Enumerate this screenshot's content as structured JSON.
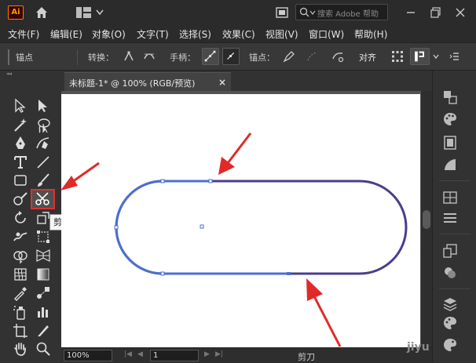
{
  "app": {
    "logo_text": "Ai"
  },
  "search": {
    "placeholder": "搜索 Adobe 帮助"
  },
  "menu": {
    "items": [
      "文件(F)",
      "编辑(E)",
      "对象(O)",
      "文字(T)",
      "选择(S)",
      "效果(C)",
      "视图(V)",
      "窗口(W)",
      "帮助(H)"
    ]
  },
  "control": {
    "anchor_label": "锚点",
    "convert_label": "转换：",
    "handle_label": "手柄：",
    "anchor_point_label": "锚点：",
    "align_label": "对齐"
  },
  "document": {
    "tab_title": "未标题-1* @ 100% (RGB/预览)",
    "close_glyph": "×"
  },
  "tooltip": {
    "text": "剪刀工具 (C)"
  },
  "status": {
    "zoom": "100%",
    "page": "1",
    "current_tool": "剪刀"
  },
  "watermark": {
    "text": "jiyu"
  },
  "colors": {
    "path_stroke": "#4b3c8c",
    "selection_blue": "#4a6fd0",
    "arrow_red": "#e02a2a",
    "highlight_red": "#e03030"
  }
}
